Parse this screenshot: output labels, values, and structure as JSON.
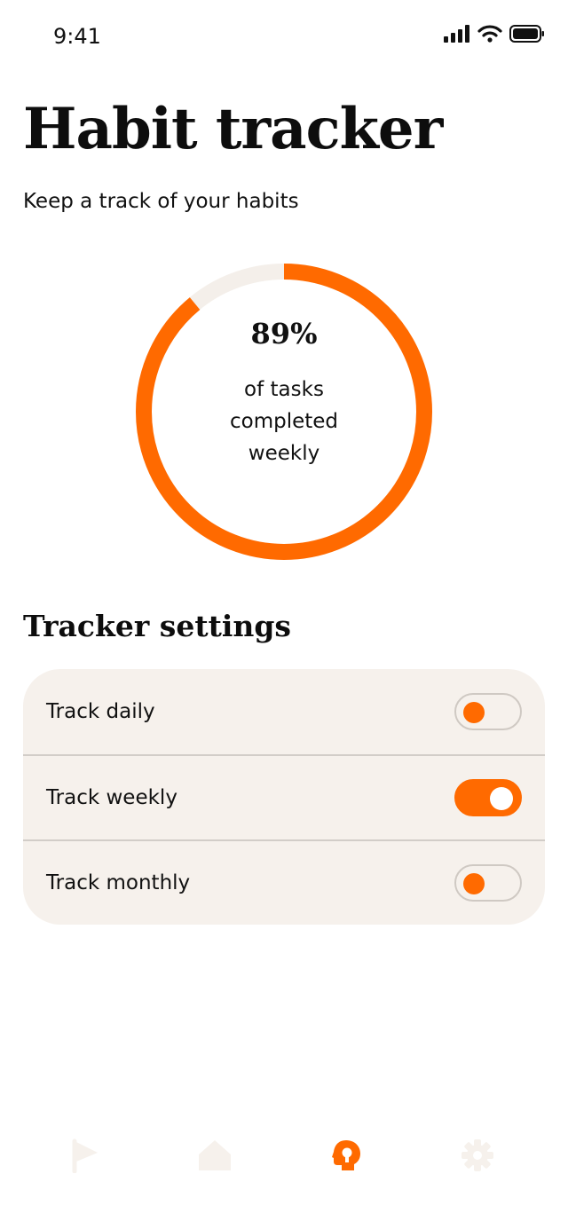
{
  "status_bar": {
    "time": "9:41",
    "icons": [
      "signal-icon",
      "wifi-icon",
      "battery-icon"
    ]
  },
  "header": {
    "title": "Habit tracker",
    "subtitle": "Keep a track of your habits"
  },
  "progress": {
    "percent_label": "89%",
    "value": 0.89,
    "caption": "of tasks completed weekly",
    "accent_color": "#ff6a00",
    "track_color": "#f4efea"
  },
  "settings": {
    "title": "Tracker settings",
    "items": [
      {
        "label": "Track daily",
        "enabled": false
      },
      {
        "label": "Track weekly",
        "enabled": true
      },
      {
        "label": "Track monthly",
        "enabled": false
      }
    ]
  },
  "bottom_nav": {
    "items": [
      {
        "icon": "flag-icon",
        "active": false
      },
      {
        "icon": "home-icon",
        "active": false
      },
      {
        "icon": "habit-icon",
        "active": true
      },
      {
        "icon": "gear-icon",
        "active": false
      }
    ],
    "active_color": "#ff6a00",
    "inactive_color": "#f6f1ec"
  }
}
